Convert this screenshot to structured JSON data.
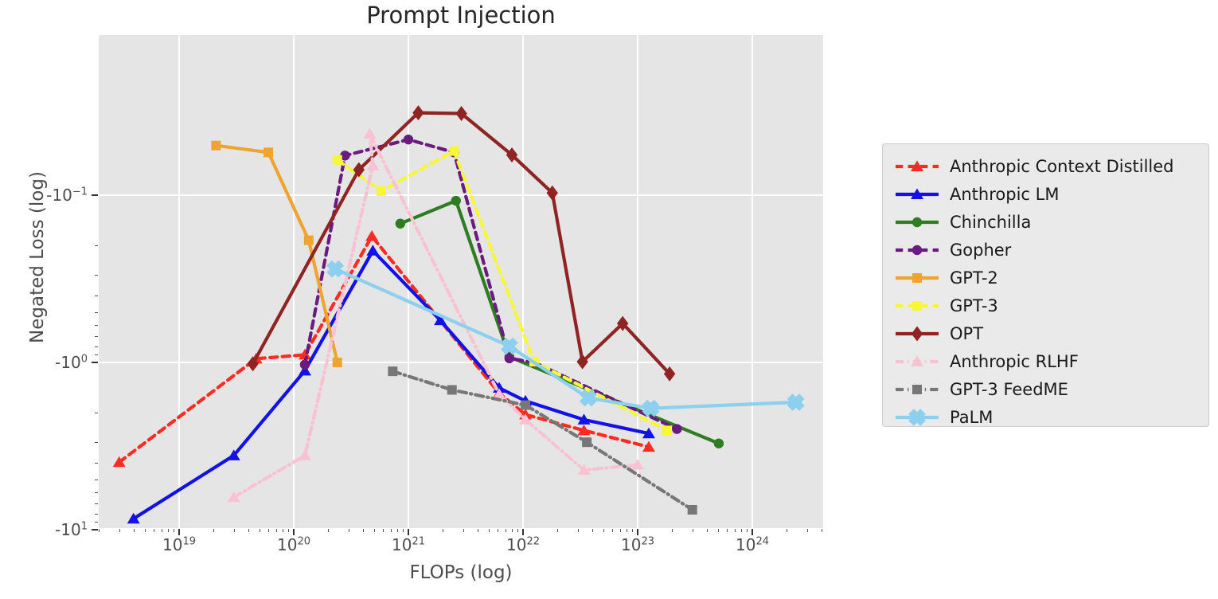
{
  "chart_data": {
    "type": "line",
    "title": "Prompt Injection",
    "xlabel": "FLOPs (log)",
    "ylabel": "Negated Loss (log)",
    "xscale": "log",
    "yscale": "symlog-negative",
    "grid": true,
    "legend_position": "right-outside",
    "xlim": [
      1.6e+18,
      1.3e+25
    ],
    "ylim": [
      -11.0,
      -0.05
    ],
    "xticks": [
      "10^19",
      "10^20",
      "10^21",
      "10^22",
      "10^23",
      "10^24"
    ],
    "yticks": [
      "-10^-1",
      "-10^0",
      "-10^1"
    ],
    "series": [
      {
        "name": "Anthropic Context Distilled",
        "color": "#fc2c22",
        "marker": "triangle",
        "linestyle": "dashed",
        "points": [
          {
            "x": 3e+18,
            "y": -3.95
          },
          {
            "x": 4.7e+19,
            "y": -0.95
          },
          {
            "x": 1.25e+20,
            "y": -0.9
          },
          {
            "x": 4.8e+20,
            "y": -0.176
          },
          {
            "x": 6.2e+21,
            "y": -1.53
          },
          {
            "x": 1.05e+22,
            "y": -2.05
          },
          {
            "x": 3.4e+22,
            "y": -2.55
          },
          {
            "x": 1.25e+23,
            "y": -3.2
          }
        ]
      },
      {
        "name": "Anthropic LM",
        "color": "#1212e8",
        "marker": "triangle",
        "linestyle": "solid",
        "points": [
          {
            "x": 4e+18,
            "y": -8.6
          },
          {
            "x": 3e+19,
            "y": -3.6
          },
          {
            "x": 1.25e+20,
            "y": -1.12
          },
          {
            "x": 4.9e+20,
            "y": -0.215
          },
          {
            "x": 1.9e+21,
            "y": -0.56
          },
          {
            "x": 6.2e+21,
            "y": -1.42
          },
          {
            "x": 1.05e+22,
            "y": -1.7
          },
          {
            "x": 3.4e+22,
            "y": -2.2
          },
          {
            "x": 1.25e+23,
            "y": -2.66
          }
        ]
      },
      {
        "name": "Chinchilla",
        "color": "#2f7d22",
        "marker": "circle",
        "linestyle": "solid",
        "points": [
          {
            "x": 8.5e+20,
            "y": -0.148
          },
          {
            "x": 2.6e+21,
            "y": -0.108
          },
          {
            "x": 7.6e+21,
            "y": -0.925
          },
          {
            "x": 5.1e+23,
            "y": -3.05
          }
        ]
      },
      {
        "name": "Gopher",
        "color": "#6a1b7f",
        "marker": "circle",
        "linestyle": "dashed",
        "points": [
          {
            "x": 1.25e+20,
            "y": -1.03
          },
          {
            "x": 2.8e+20,
            "y": -0.058
          },
          {
            "x": 1e+21,
            "y": -0.0465
          },
          {
            "x": 2.5e+21,
            "y": -0.0555
          },
          {
            "x": 7.6e+21,
            "y": -0.945
          },
          {
            "x": 1.25e+22,
            "y": -1.0
          },
          {
            "x": 2.2e+23,
            "y": -2.5
          }
        ]
      },
      {
        "name": "GPT-2",
        "color": "#f0a430",
        "marker": "square",
        "linestyle": "solid",
        "points": [
          {
            "x": 2.1e+19,
            "y": -0.0505
          },
          {
            "x": 6e+19,
            "y": -0.0555
          },
          {
            "x": 1.35e+20,
            "y": -0.186
          },
          {
            "x": 2.4e+20,
            "y": -1.0
          }
        ]
      },
      {
        "name": "GPT-3",
        "color": "#f7f735",
        "marker": "square",
        "linestyle": "dashed",
        "points": [
          {
            "x": 2.4e+20,
            "y": -0.0615
          },
          {
            "x": 5.8e+20,
            "y": -0.0945
          },
          {
            "x": 2.5e+21,
            "y": -0.0545
          },
          {
            "x": 1.25e+22,
            "y": -0.99
          },
          {
            "x": 1.8e+23,
            "y": -2.55
          }
        ]
      },
      {
        "name": "OPT",
        "color": "#8f2423",
        "marker": "diamond",
        "linestyle": "solid",
        "points": [
          {
            "x": 4.4e+19,
            "y": -1.02
          },
          {
            "x": 3.7e+20,
            "y": -0.0705
          },
          {
            "x": 1.22e+21,
            "y": -0.0322
          },
          {
            "x": 2.9e+21,
            "y": -0.0325
          },
          {
            "x": 8e+21,
            "y": -0.0575
          },
          {
            "x": 1.8e+22,
            "y": -0.097
          },
          {
            "x": 3.3e+22,
            "y": -0.99
          },
          {
            "x": 7.4e+22,
            "y": -0.585
          },
          {
            "x": 1.9e+23,
            "y": -1.17
          }
        ]
      },
      {
        "name": "Anthropic RLHF",
        "color": "#f9c2d2",
        "marker": "triangle",
        "linestyle": "dashdot",
        "points": [
          {
            "x": 3e+19,
            "y": -6.4
          },
          {
            "x": 1.25e+20,
            "y": -3.6
          },
          {
            "x": 4.9e+20,
            "y": -0.0665
          },
          {
            "x": 4.6e+20,
            "y": -0.043
          },
          {
            "x": 6.2e+21,
            "y": -1.55
          },
          {
            "x": 1.05e+22,
            "y": -2.2
          },
          {
            "x": 3.4e+22,
            "y": -4.4
          },
          {
            "x": 1e+23,
            "y": -4.1
          }
        ]
      },
      {
        "name": "GPT-3 FeedME",
        "color": "#777777",
        "marker": "square",
        "linestyle": "dashdot",
        "points": [
          {
            "x": 7.3e+20,
            "y": -1.13
          },
          {
            "x": 2.4e+21,
            "y": -1.46
          },
          {
            "x": 1.05e+22,
            "y": -1.8
          },
          {
            "x": 3.6e+22,
            "y": -3.0
          },
          {
            "x": 3e+23,
            "y": -7.6
          }
        ]
      },
      {
        "name": "PaLM",
        "color": "#8ccfee",
        "marker": "x",
        "linestyle": "solid",
        "points": [
          {
            "x": 2.3e+20,
            "y": -0.276
          },
          {
            "x": 7.6e+21,
            "y": -0.8
          },
          {
            "x": 3.7e+22,
            "y": -1.63
          },
          {
            "x": 1.3e+23,
            "y": -1.88
          },
          {
            "x": 2.4e+24,
            "y": -1.73
          }
        ]
      }
    ]
  },
  "axes": {
    "title": "Prompt Injection",
    "xlabel": "FLOPs (log)",
    "ylabel": "Negated Loss (log)",
    "xticks": [
      {
        "base": "10",
        "exp": "19"
      },
      {
        "base": "10",
        "exp": "20"
      },
      {
        "base": "10",
        "exp": "21"
      },
      {
        "base": "10",
        "exp": "22"
      },
      {
        "base": "10",
        "exp": "23"
      },
      {
        "base": "10",
        "exp": "24"
      }
    ],
    "yticks": [
      {
        "prefix": "-10",
        "exp": "−1"
      },
      {
        "prefix": "-10",
        "exp": "0"
      },
      {
        "prefix": "-10",
        "exp": "1"
      }
    ]
  },
  "legend": {
    "items": [
      {
        "label": "Anthropic Context Distilled",
        "color": "#fc2c22",
        "marker": "triangle",
        "linestyle": "dashed"
      },
      {
        "label": "Anthropic LM",
        "color": "#1212e8",
        "marker": "triangle",
        "linestyle": "solid"
      },
      {
        "label": "Chinchilla",
        "color": "#2f7d22",
        "marker": "circle",
        "linestyle": "solid"
      },
      {
        "label": "Gopher",
        "color": "#6a1b7f",
        "marker": "circle",
        "linestyle": "dashed"
      },
      {
        "label": "GPT-2",
        "color": "#f0a430",
        "marker": "square",
        "linestyle": "solid"
      },
      {
        "label": "GPT-3",
        "color": "#f7f735",
        "marker": "square",
        "linestyle": "dashed"
      },
      {
        "label": "OPT",
        "color": "#8f2423",
        "marker": "diamond",
        "linestyle": "solid"
      },
      {
        "label": "Anthropic RLHF",
        "color": "#f9c2d2",
        "marker": "triangle",
        "linestyle": "dashdot"
      },
      {
        "label": "GPT-3 FeedME",
        "color": "#777777",
        "marker": "square",
        "linestyle": "dashdot"
      },
      {
        "label": "PaLM",
        "color": "#8ccfee",
        "marker": "x",
        "linestyle": "solid"
      }
    ]
  }
}
